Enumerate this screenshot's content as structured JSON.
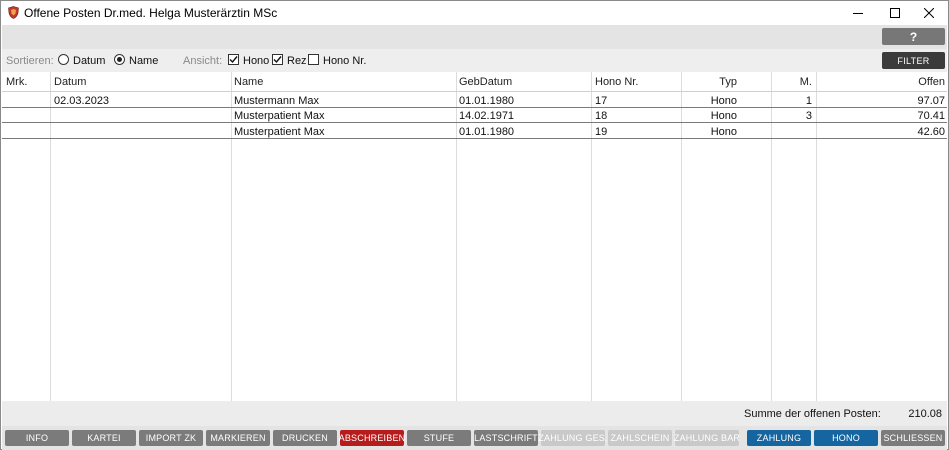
{
  "window": {
    "title": "Offene Posten Dr.med. Helga Musterärztin MSc",
    "icon": "app-shield-icon",
    "controls": [
      "minimize-icon",
      "maximize-icon",
      "close-icon"
    ]
  },
  "toolbar": {
    "help_label": "?"
  },
  "sortbar": {
    "sort_label": "Sortieren:",
    "sort_options": [
      {
        "label": "Datum",
        "selected": false
      },
      {
        "label": "Name",
        "selected": true
      }
    ],
    "view_label": "Ansicht:",
    "view_options": [
      {
        "label": "Hono",
        "checked": true
      },
      {
        "label": "Rez",
        "checked": true
      },
      {
        "label": "Hono Nr.",
        "checked": false
      }
    ],
    "filter_label": "FILTER"
  },
  "table": {
    "columns": [
      "Mrk.",
      "Datum",
      "Name",
      "GebDatum",
      "Hono Nr.",
      "Typ",
      "M.",
      "Offen"
    ],
    "rows": [
      {
        "mrk": "",
        "datum": "02.03.2023",
        "name": "Mustermann Max",
        "gebdatum": "01.01.1980",
        "hono_nr": "17",
        "typ": "Hono",
        "m": "1",
        "offen": "97.07"
      },
      {
        "mrk": "",
        "datum": "",
        "name": "Musterpatient Max",
        "gebdatum": "14.02.1971",
        "hono_nr": "18",
        "typ": "Hono",
        "m": "3",
        "offen": "70.41"
      },
      {
        "mrk": "",
        "datum": "",
        "name": "Musterpatient Max",
        "gebdatum": "01.01.1980",
        "hono_nr": "19",
        "typ": "Hono",
        "m": "",
        "offen": "42.60"
      }
    ]
  },
  "summary": {
    "label": "Summe der offenen Posten:",
    "value": "210.08"
  },
  "buttons": [
    {
      "label": "INFO",
      "state": "normal"
    },
    {
      "label": "KARTEI",
      "state": "normal"
    },
    {
      "label": "IMPORT ZK",
      "state": "normal"
    },
    {
      "label": "MARKIEREN",
      "state": "normal"
    },
    {
      "label": "DRUCKEN",
      "state": "normal"
    },
    {
      "label": "ABSCHREIBEN",
      "state": "danger"
    },
    {
      "label": "STUFE",
      "state": "normal"
    },
    {
      "label": "LASTSCHRIFT",
      "state": "normal"
    },
    {
      "label": "ZAHLUNG GES.",
      "state": "disabled"
    },
    {
      "label": "ZAHLSCHEIN",
      "state": "disabled"
    },
    {
      "label": "ZAHLUNG BAR",
      "state": "disabled"
    },
    {
      "label": "ZAHLUNG",
      "state": "primary"
    },
    {
      "label": "HONO",
      "state": "primary"
    },
    {
      "label": "SCHLIESSEN",
      "state": "normal"
    }
  ],
  "colors": {
    "button_normal": "#7b7b7b",
    "button_danger": "#b71c1c",
    "button_disabled": "#c9c9c9",
    "button_primary": "#1565a0",
    "filter_button": "#3b3b3b"
  }
}
